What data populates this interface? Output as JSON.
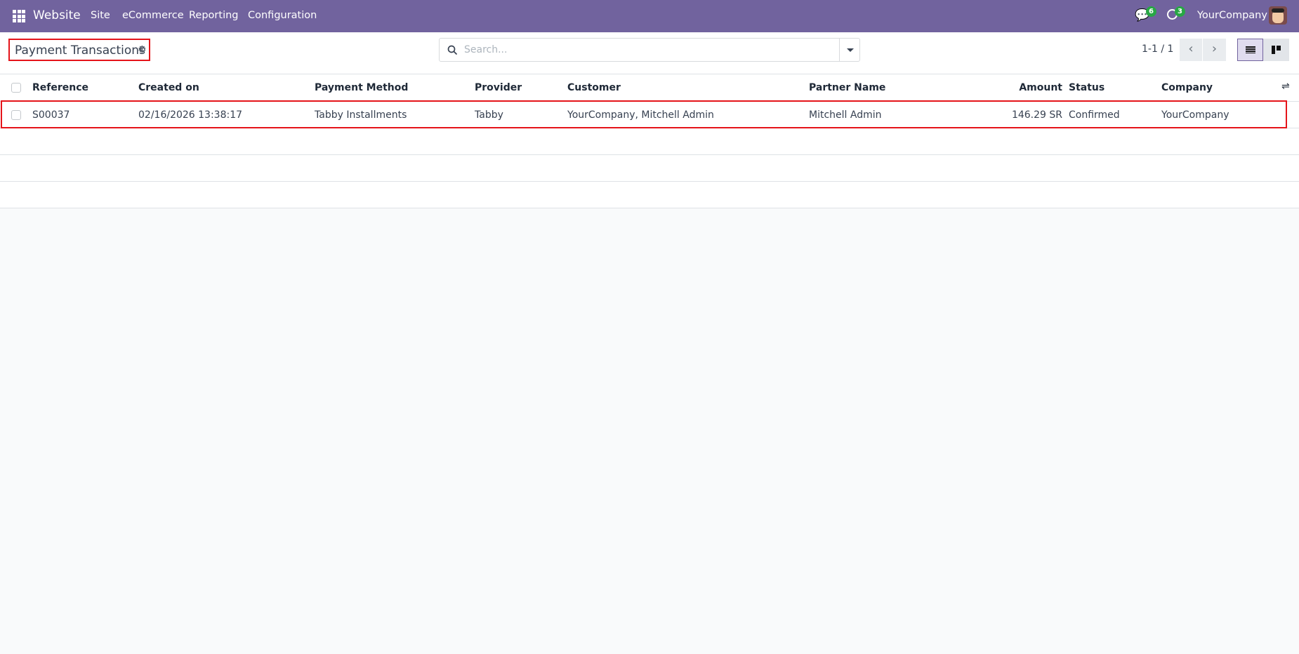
{
  "navbar": {
    "app": "Website",
    "menus": [
      "Site",
      "eCommerce",
      "Reporting",
      "Configuration"
    ],
    "messages_count": "6",
    "activities_count": "3",
    "company": "YourCompany"
  },
  "control": {
    "title": "Payment Transactions",
    "search_placeholder": "Search...",
    "pager": "1-1 / 1"
  },
  "table": {
    "columns": [
      "Reference",
      "Created on",
      "Payment Method",
      "Provider",
      "Customer",
      "Partner Name",
      "Amount",
      "Status",
      "Company"
    ],
    "rows": [
      [
        "S00037",
        "02/16/2026 13:38:17",
        "Tabby Installments",
        "Tabby",
        "YourCompany, Mitchell Admin",
        "Mitchell Admin",
        "146.29 SR",
        "Confirmed",
        "YourCompany"
      ]
    ]
  },
  "colors": {
    "navbar": "#71639e",
    "highlight": "#e5141a",
    "badge": "#28a745"
  }
}
